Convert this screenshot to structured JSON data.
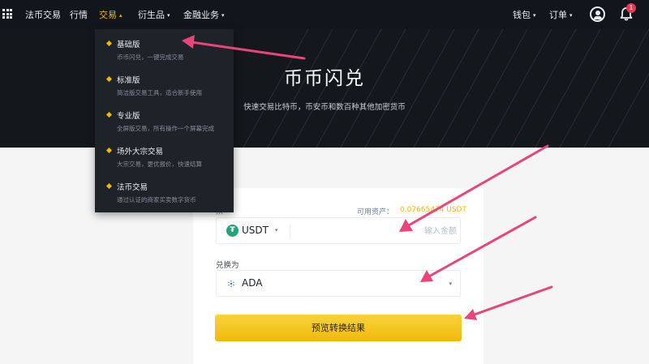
{
  "nav": {
    "items": [
      {
        "label": "法币交易"
      },
      {
        "label": "行情"
      },
      {
        "label": "交易"
      },
      {
        "label": "衍生品"
      },
      {
        "label": "金融业务"
      }
    ],
    "right": {
      "wallet": "钱包",
      "orders": "订单",
      "notification_count": "1"
    },
    "caret": "▾",
    "active_caret": "▴"
  },
  "dropdown": {
    "items": [
      {
        "title": "基础版",
        "desc": "币币闪兑，一键完成交易"
      },
      {
        "title": "标准版",
        "desc": "简洁版交易工具，适合新手使用"
      },
      {
        "title": "专业版",
        "desc": "全屏版交易，所有操作一个屏幕完成"
      },
      {
        "title": "场外大宗交易",
        "desc": "大宗交易，更优报价，快速结算"
      },
      {
        "title": "法币交易",
        "desc": "通过认证的商家买卖数字货币"
      }
    ]
  },
  "hero": {
    "title": "币币闪兑",
    "subtitle": "快速交易比特币，币安币和数百种其他加密货币"
  },
  "convert": {
    "from_label": "从",
    "available_label": "可用资产：",
    "available_value": "0.07665474 USDT",
    "from_coin": "USDT",
    "from_coin_icon": "tether-icon",
    "amount_placeholder": "输入金额",
    "to_label": "兑换为",
    "to_coin": "ADA",
    "to_coin_icon": "cardano-icon",
    "preview_button": "预览转换结果"
  },
  "colors": {
    "accent": "#f0b90b",
    "topbar": "#12161c",
    "annotation_arrow": "#e8457a",
    "tether": "#26a17b",
    "badge": "#e33b54"
  }
}
